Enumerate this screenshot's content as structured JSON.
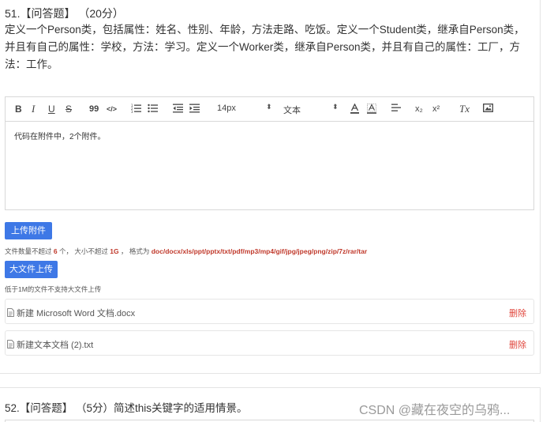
{
  "question1": {
    "header": "51.【问答题】 （20分）",
    "body": "定义一个Person类，包括属性：姓名、性别、年龄，方法走路、吃饭。定义一个Student类，继承自Person类，并且有自己的属性：学校，方法：学习。定义一个Worker类，继承自Person类，并且有自己的属性：工厂，方法：工作。"
  },
  "toolbar": {
    "bold": "B",
    "italic": "I",
    "underline": "U",
    "strike": "S",
    "quote": "99",
    "code": "</>",
    "font_size": "14px",
    "text_style": "文本",
    "subscript": "x₂",
    "superscript": "x²",
    "clear_format": "Tx"
  },
  "editor": {
    "content": "代码在附件中，2个附件。"
  },
  "upload": {
    "button_label": "上传附件",
    "hint_prefix": "文件数量不超过",
    "max_count": "6",
    "hint_count_unit": "个，  大小不超过",
    "max_size": "1G",
    "hint_format_prefix": "，  格式为",
    "formats": "doc/docx/xls/ppt/pptx/txt/pdf/mp3/mp4/gif/jpg/jpeg/png/zip/7z/rar/tar",
    "big_button_label": "大文件上传",
    "big_hint": "低于1M的文件不支持大文件上传"
  },
  "attachments": [
    {
      "name": "新建 Microsoft Word 文档.docx",
      "delete_label": "删除"
    },
    {
      "name": "新建文本文档 (2).txt",
      "delete_label": "删除"
    }
  ],
  "question2": {
    "header": "52.【问答题】 （5分）简述this关键字的适用情景。"
  },
  "watermark": "CSDN @藏在夜空的乌鸦..."
}
